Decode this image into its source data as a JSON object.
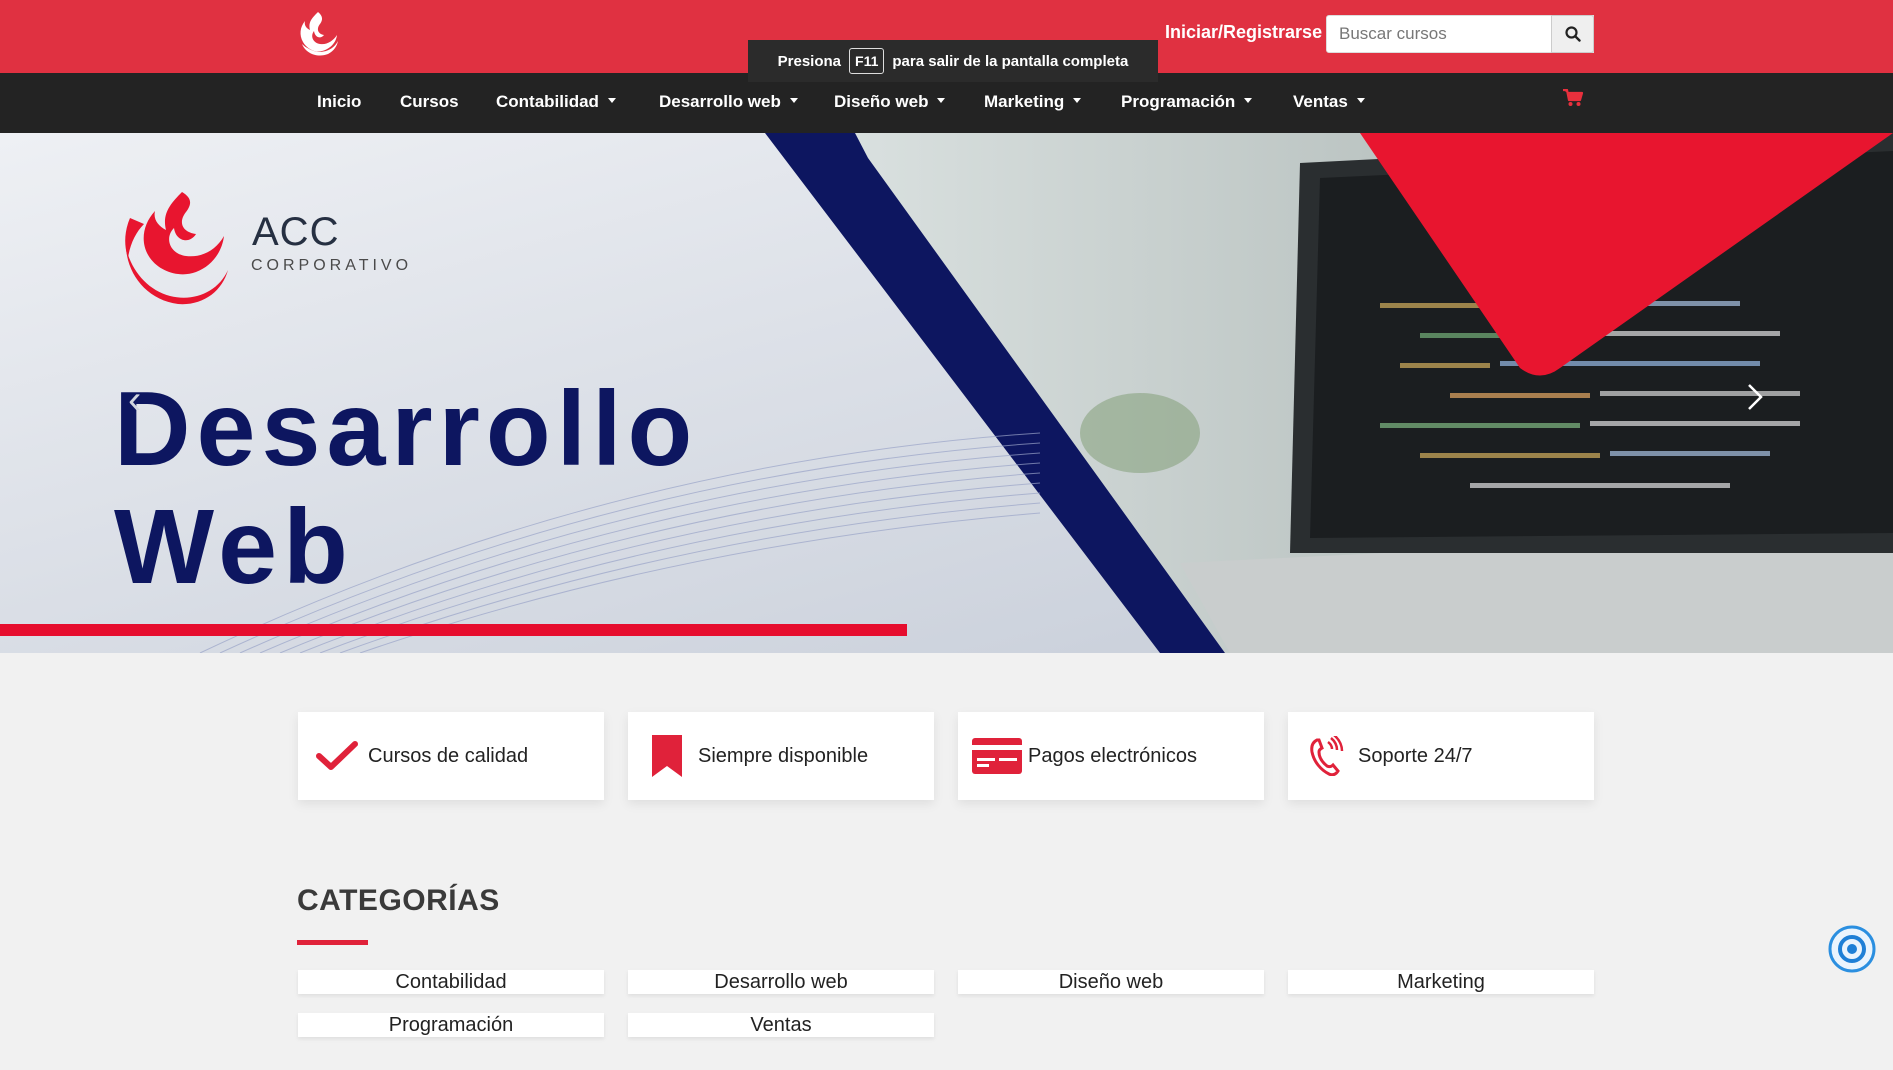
{
  "header": {
    "login_label": "Iniciar/Registrarse",
    "search_placeholder": "Buscar cursos",
    "brand_color": "#e03141"
  },
  "fullscreen_notice": {
    "prefix": "Presiona",
    "key": "F11",
    "suffix": "para salir de la pantalla completa"
  },
  "nav": {
    "items": [
      {
        "label": "Inicio",
        "dropdown": false
      },
      {
        "label": "Cursos",
        "dropdown": false
      },
      {
        "label": "Contabilidad",
        "dropdown": true
      },
      {
        "label": "Desarrollo web",
        "dropdown": true
      },
      {
        "label": "Diseño web",
        "dropdown": true
      },
      {
        "label": "Marketing",
        "dropdown": true
      },
      {
        "label": "Programación",
        "dropdown": true
      },
      {
        "label": "Ventas",
        "dropdown": true
      }
    ]
  },
  "hero": {
    "brand_name": "ACC",
    "brand_sub": "CORPORATIVO",
    "title_line1": "Desarrollo",
    "title_line2": "Web"
  },
  "features": [
    {
      "label": "Cursos de calidad",
      "icon": "check-icon"
    },
    {
      "label": "Siempre disponible",
      "icon": "bookmark-icon"
    },
    {
      "label": "Pagos electrónicos",
      "icon": "credit-card-icon"
    },
    {
      "label": "Soporte 24/7",
      "icon": "phone-icon"
    }
  ],
  "categories": {
    "heading": "CATEGORÍAS",
    "items": [
      "Contabilidad",
      "Desarrollo web",
      "Diseño web",
      "Marketing",
      "Programación",
      "Ventas"
    ]
  }
}
